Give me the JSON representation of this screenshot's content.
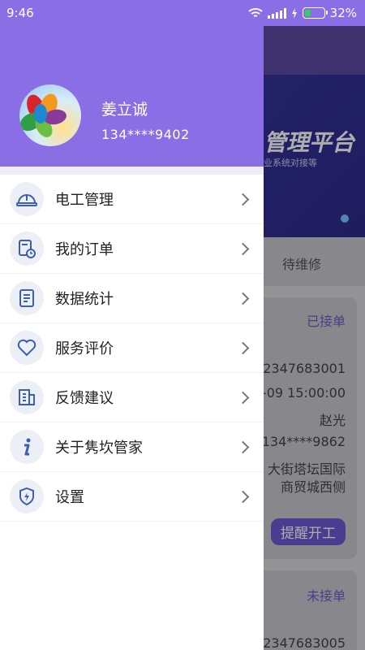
{
  "status_bar": {
    "time": "9:46",
    "battery": "32%"
  },
  "profile": {
    "name": "姜立诚",
    "phone": "134****9402"
  },
  "menu": [
    {
      "label": "电工管理",
      "icon": "helmet-icon"
    },
    {
      "label": "我的订单",
      "icon": "order-icon"
    },
    {
      "label": "数据统计",
      "icon": "document-icon"
    },
    {
      "label": "服务评价",
      "icon": "heart-icon"
    },
    {
      "label": "反馈建议",
      "icon": "building-icon"
    },
    {
      "label": "关于隽坎管家",
      "icon": "info-icon"
    },
    {
      "label": "设置",
      "icon": "shield-lightning-icon"
    }
  ],
  "background": {
    "banner_title": "管理平台",
    "banner_subtitle": "业系统对接等",
    "tab": "待维修",
    "card1": {
      "status": "已接单",
      "order_no": "2347683001",
      "time": "-09 15:00:00",
      "name": "赵光",
      "phone": "134****9862",
      "address_line1": "大街塔坛国际",
      "address_line2": "商贸城西侧",
      "button": "提醒开工"
    },
    "card2": {
      "status": "未接单",
      "order_no": "2347683005"
    }
  },
  "colors": {
    "accent": "#8a6ee6",
    "icon_blue": "#3c5fae"
  }
}
